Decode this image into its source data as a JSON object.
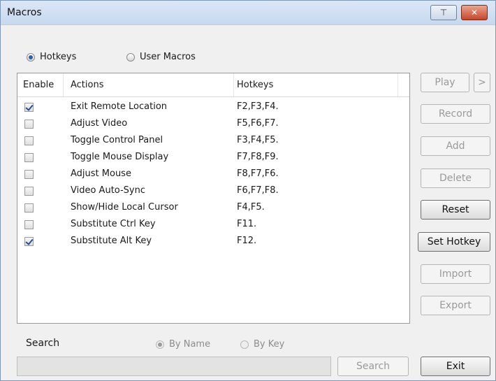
{
  "window": {
    "title": "Macros",
    "pin_glyph": "⊤",
    "close_glyph": "✕"
  },
  "mode": {
    "hotkeys_label": "Hotkeys",
    "user_macros_label": "User Macros",
    "selected": "Hotkeys"
  },
  "table": {
    "headers": {
      "enable": "Enable",
      "actions": "Actions",
      "hotkeys": "Hotkeys"
    },
    "rows": [
      {
        "enabled": true,
        "action": "Exit Remote Location",
        "hotkeys": "F2,F3,F4."
      },
      {
        "enabled": false,
        "action": "Adjust Video",
        "hotkeys": "F5,F6,F7."
      },
      {
        "enabled": false,
        "action": "Toggle Control Panel",
        "hotkeys": "F3,F4,F5."
      },
      {
        "enabled": false,
        "action": "Toggle Mouse Display",
        "hotkeys": "F7,F8,F9."
      },
      {
        "enabled": false,
        "action": "Adjust Mouse",
        "hotkeys": "F8,F7,F6."
      },
      {
        "enabled": false,
        "action": "Video Auto-Sync",
        "hotkeys": "F6,F7,F8."
      },
      {
        "enabled": false,
        "action": "Show/Hide Local Cursor",
        "hotkeys": "F4,F5."
      },
      {
        "enabled": false,
        "action": "Substitute Ctrl Key",
        "hotkeys": "F11."
      },
      {
        "enabled": true,
        "action": "Substitute Alt Key",
        "hotkeys": "F12."
      }
    ]
  },
  "buttons": {
    "play": "Play",
    "play_more": ">",
    "record": "Record",
    "add": "Add",
    "delete": "Delete",
    "reset": "Reset",
    "set_hotkey": "Set Hotkey",
    "import": "Import",
    "export": "Export",
    "exit": "Exit"
  },
  "search": {
    "label": "Search",
    "by_name": "By Name",
    "by_key": "By Key",
    "selected": "By Name",
    "value": "",
    "button": "Search"
  }
}
